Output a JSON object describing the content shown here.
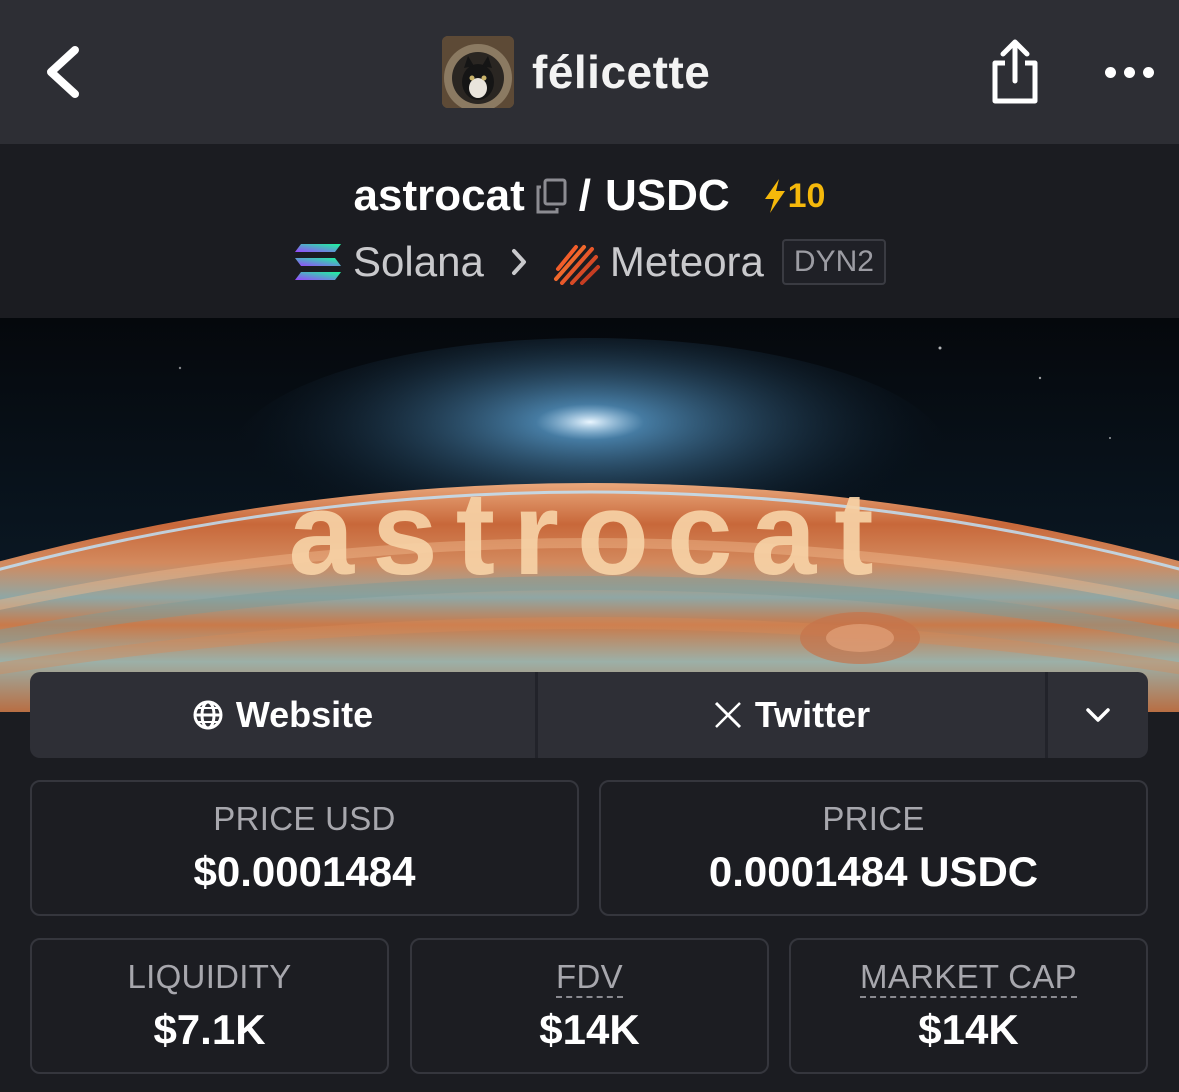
{
  "nav": {
    "title": "félicette",
    "back_icon": "chevron-left-icon",
    "share_icon": "share-icon",
    "more_icon": "more-horizontal-icon"
  },
  "pair": {
    "base": "astrocat",
    "slash": "/",
    "quote": "USDC",
    "boost_count": "10",
    "chain": "Solana",
    "dex": "Meteora",
    "dex_badge": "DYN2"
  },
  "banner": {
    "text": "astrocat"
  },
  "links": {
    "website": "Website",
    "twitter": "Twitter"
  },
  "stats": {
    "price_usd_label": "PRICE USD",
    "price_usd_value": "$0.0001484",
    "price_label": "PRICE",
    "price_value": "0.0001484 USDC",
    "liquidity_label": "LIQUIDITY",
    "liquidity_value": "$7.1K",
    "fdv_label": "FDV",
    "fdv_value": "$14K",
    "mcap_label": "MARKET CAP",
    "mcap_value": "$14K"
  },
  "colors": {
    "background": "#1b1c21",
    "nav_bar": "#2d2e34",
    "boost": "#f5b80b",
    "button_bg": "#2e2f36"
  }
}
